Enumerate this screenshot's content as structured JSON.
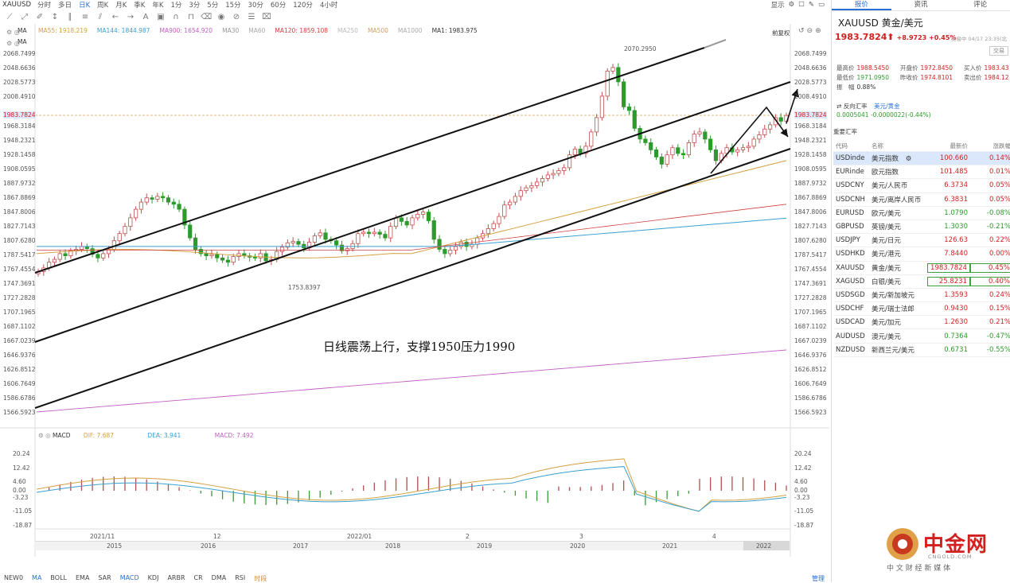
{
  "topbar": {
    "symbol": "XAUUSD",
    "periods": [
      "分时",
      "多日",
      "日K",
      "周K",
      "月K",
      "季K",
      "年K",
      "1分",
      "3分",
      "5分",
      "15分",
      "30分",
      "60分",
      "120分",
      "4小时"
    ],
    "active_period": "日K",
    "display_label": "显示"
  },
  "ma_panel": {
    "row1": [
      "MA",
      ""
    ],
    "items": [
      {
        "label": "MA55: 1918.219",
        "color": "#d4a040"
      },
      {
        "label": "MA144: 1844.987",
        "color": "#3aa0d0"
      },
      {
        "label": "MA900: 1654.920",
        "color": "#c060c0"
      },
      {
        "label": "MA30",
        "color": "#999999"
      },
      {
        "label": "MA60",
        "color": "#aaaaaa"
      },
      {
        "label": "MA120: 1859.108",
        "color": "#d04040"
      },
      {
        "label": "MA250",
        "color": "#bbbbbb"
      },
      {
        "label": "MA500",
        "color": "#d0a060"
      },
      {
        "label": "MA1000",
        "color": "#aaaaaa"
      },
      {
        "label": "MA1: 1983.975",
        "color": "#333333"
      }
    ],
    "row2": "MA",
    "restore": "前复权"
  },
  "price_axis": [
    "2068.7499",
    "2048.6636",
    "2028.5773",
    "2008.4910",
    "1983.7824",
    "1968.3184",
    "1948.2321",
    "1928.1458",
    "1908.0595",
    "1887.9732",
    "1867.8869",
    "1847.8006",
    "1827.7143",
    "1807.6280",
    "1787.5417",
    "1767.4554",
    "1747.3691",
    "1727.2828",
    "1707.1965",
    "1687.1102",
    "1667.0239",
    "1646.9376",
    "1626.8512",
    "1606.7649",
    "1586.6786",
    "1566.5923"
  ],
  "current_price_label": "1983.7824",
  "annotations": {
    "high": "2070.2950",
    "low": "1753.8397",
    "comment": "日线震荡上行，支撑1950压力1990"
  },
  "macd": {
    "label": "MACD",
    "dif": "DIF: 7.687",
    "dea": "DEA: 3.941",
    "macd": "MACD: 7.492",
    "axis": [
      "20.24",
      "12.42",
      "4.60",
      "0.00",
      "-3.23",
      "-11.05",
      "-18.87"
    ]
  },
  "date_axis_upper": [
    "2021/11",
    "12",
    "2022/01",
    "2",
    "3",
    "4"
  ],
  "date_axis_lower": [
    "2015",
    "2016",
    "2017",
    "2018",
    "2019",
    "2020",
    "2021",
    "2022"
  ],
  "indicator_tabs": [
    "NEW0",
    "MA",
    "BOLL",
    "EMA",
    "SAR",
    "MACD",
    "KDJ",
    "ARBR",
    "CR",
    "DMA",
    "RSI",
    "时段"
  ],
  "indicator_tabs_right": "管理",
  "right_panel": {
    "tabs": [
      "报价",
      "资讯",
      "评论"
    ],
    "title": "XAUUSD  黄金/美元",
    "price": "1983.7824",
    "change": "+8.9723 +0.45%",
    "time": "交易中 04/17 23:35(北",
    "stats": [
      {
        "k": "最高价",
        "v": "1988.5450"
      },
      {
        "k": "开盘价",
        "v": "1972.8450"
      },
      {
        "k": "买入价",
        "v": "1983.43"
      },
      {
        "k": "最低价",
        "v": "1971.0950"
      },
      {
        "k": "昨收价",
        "v": "1974.8101"
      },
      {
        "k": "卖出价",
        "v": "1984.12"
      },
      {
        "k": "振　幅",
        "v": "0.88%"
      }
    ],
    "cross_label": "反向汇率",
    "cross_pair": "美元/黄金",
    "cross_value": "0.0005041  -0.0000022(-0.44%)",
    "watch_title": "重要汇率",
    "watch_headers": [
      "代码",
      "名称",
      "最新价",
      "涨跌幅"
    ],
    "watch": [
      {
        "code": "USDinde",
        "name": "美元指数",
        "price": "100.660",
        "chg": "0.14%",
        "up": true
      },
      {
        "code": "EURinde",
        "name": "欧元指数",
        "price": "101.485",
        "chg": "0.01%",
        "up": true
      },
      {
        "code": "USDCNY",
        "name": "美元/人民币",
        "price": "6.3734",
        "chg": "0.05%",
        "up": true
      },
      {
        "code": "USDCNH",
        "name": "美元/离岸人民币",
        "price": "6.3831",
        "chg": "0.05%",
        "up": true
      },
      {
        "code": "EURUSD",
        "name": "欧元/美元",
        "price": "1.0790",
        "chg": "-0.08%",
        "up": false
      },
      {
        "code": "GBPUSD",
        "name": "英镑/美元",
        "price": "1.3030",
        "chg": "-0.21%",
        "up": false
      },
      {
        "code": "USDJPY",
        "name": "美元/日元",
        "price": "126.63",
        "chg": "0.22%",
        "up": true
      },
      {
        "code": "USDHKD",
        "name": "美元/港元",
        "price": "7.8440",
        "chg": "0.00%",
        "up": true
      },
      {
        "code": "XAUUSD",
        "name": "黄金/美元",
        "price": "1983.7824",
        "chg": "0.45%",
        "up": true
      },
      {
        "code": "XAGUSD",
        "name": "白银/美元",
        "price": "25.8231",
        "chg": "0.40%",
        "up": true
      },
      {
        "code": "USDSGD",
        "name": "美元/新加坡元",
        "price": "1.3593",
        "chg": "0.24%",
        "up": true
      },
      {
        "code": "USDCHF",
        "name": "美元/瑞士法郎",
        "price": "0.9430",
        "chg": "0.15%",
        "up": true
      },
      {
        "code": "USDCAD",
        "name": "美元/加元",
        "price": "1.2630",
        "chg": "0.21%",
        "up": true
      },
      {
        "code": "AUDUSD",
        "name": "澳元/美元",
        "price": "0.7364",
        "chg": "-0.47%",
        "up": false
      },
      {
        "code": "NZDUSD",
        "name": "新西兰元/美元",
        "price": "0.6731",
        "chg": "-0.55%",
        "up": false
      }
    ]
  },
  "logo": {
    "name": "中金网",
    "url": "CNGOLD.COM",
    "tagline": "中 文 财 经 新 媒 体"
  },
  "colors": {
    "up": "#d21f1f",
    "down": "#2a9a2a",
    "accent": "#2a6fd6"
  }
}
